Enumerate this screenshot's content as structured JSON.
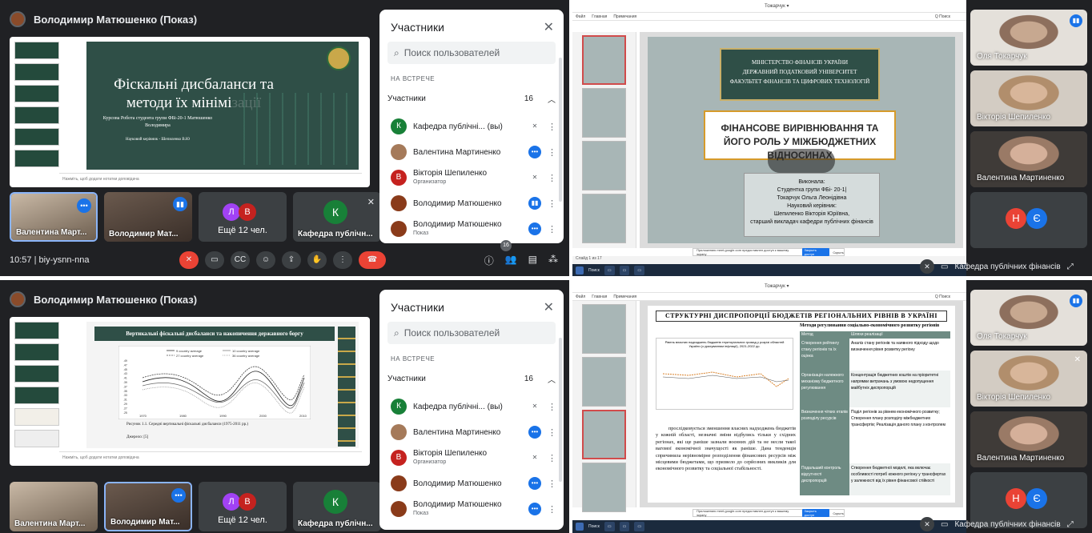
{
  "meet": {
    "presenter": "Володимир Матюшенко (Показ)",
    "slide1": {
      "title": "Фіскальні дисбаланси та методи їх мінімізації",
      "subtitle": "Курсова Робота студента групи ФБі-20-1 Матюшенко Володимира",
      "supervisor": "Науковий керівник - Шепиленко В.Ю",
      "notes": "Нажміть, щоб додати нотатки доповідача"
    },
    "slide2": {
      "title": "Вертикальні фіскальні дисбаланси та накопичення державного боргу",
      "caption": "Рисунок 1.1. Середні вертикальні фіскальні дисбаланси (1975-2011 рр.)",
      "source": "Джерело: [5]",
      "legend": [
        "9 country average",
        "10 country average",
        "27 country average",
        "36 country average"
      ],
      "xticks": [
        "1970",
        "1980",
        "1990",
        "2000",
        "2010"
      ],
      "yticks": [
        ".49",
        ".47",
        ".45",
        ".43",
        ".41",
        ".39",
        ".37",
        ".35",
        ".33",
        ".31",
        ".29",
        ".27",
        ".25"
      ]
    },
    "tiles": [
      {
        "name": "Валентина Март..."
      },
      {
        "name": "Володимир Мат..."
      },
      {
        "name": "Ещё 12 чел.",
        "avatars": [
          "Л",
          "В"
        ]
      },
      {
        "name": "Кафедра публічн...",
        "avatar": "К"
      }
    ],
    "panel": {
      "title": "Участники",
      "search_placeholder": "Поиск пользователей",
      "section": "НА ВСТРЕЧЕ",
      "group": "Участники",
      "count": "16",
      "people": [
        {
          "avatar": "К",
          "name": "Кафедра публічні... (вы)",
          "color": "#188038"
        },
        {
          "avatar": "",
          "name": "Валентина Мартиненко",
          "color": "#a57a5a"
        },
        {
          "avatar": "В",
          "name": "Вікторія Шепиленко",
          "sub": "Организатор",
          "color": "#c5221f"
        },
        {
          "avatar": "",
          "name": "Володимир Матюшенко",
          "color": "#8a3b1a"
        },
        {
          "avatar": "",
          "name": "Володимир Матюшенко",
          "sub": "Показ",
          "color": "#8a3b1a"
        }
      ]
    },
    "bottom": {
      "time": "10:57",
      "code": "biy-ysnn-nna",
      "badge": "16"
    }
  },
  "ppt": {
    "window_title": "Тожарчук ▾",
    "tabs": [
      "Файл",
      "Главная",
      "Примечания"
    ],
    "search": "Q Поиск",
    "slideA": {
      "header_lines": [
        "МІНІСТЕРСТВО ФІНАНСІВ УКРАЇНИ",
        "ДЕРЖАВНИЙ ПОДАТКОВИЙ УНІВЕРСИТЕТ",
        "ФАКУЛЬТЕТ ФІНАНСІВ ТА ЦИФРОВИХ ТЕХНОЛОГІЙ"
      ],
      "title": "ФІНАНСОВЕ ВИРІВНЮВАННЯ ТА ЙОГО РОЛЬ У МІЖБЮДЖЕТНИХ ВІДНОСИНАХ",
      "author": [
        "Виконала:",
        "Студентка групи ФБі- 20-1|",
        "Токарчук Ольга Леонідівна",
        "Науковий керівник:",
        "Шепиленко Вікторія Юріївна,",
        "старший викладач кафедри публічних фінансів"
      ]
    },
    "slideB": {
      "title": "СТРУКТУРНІ ДИСПРОПОРЦІЇ БЮДЖЕТІВ РЕГІОНАЛЬНИХ РІВНІВ В УКРАЇНІ",
      "table_title": "Методи регулювання соціально-економічного розвитку регіонів",
      "col1": "Метод",
      "col2": "Шляхи реалізації",
      "chart_title": "Рівень власних надходжень бюджетів територіальних громад у розрізі областей України (з урахуванням інфляції), 2021-2022 рр.",
      "body": "прослідковується зменшення власних надходжень бюджетів у кожній області, незначні зміни відбулись тільки у східних регіонах, які ще раніше зазнали воєнних дій та не несли такої вагомої економічної значущості як раніше. Дана тенденція спричинила нерівномірне розподілення фінансових ресурсів між місцевими бюджетами, що призвело до серйозних викликів для економічного розвитку та соціальної стабільності.",
      "rows": [
        {
          "m": "Створення рейтингу стану регіонів та їх оцінка",
          "w": "Аналіз стану регіонів та наявного підходу щодо визначення рівня розвитку регіону"
        },
        {
          "m": "Організація належного механізму бюджетного регулювання",
          "w": "Концентрація бюджетних коштів на пріоритетні напрямки витрачань з умовою недопущення майбутніх диспропорцій"
        },
        {
          "m": "Визначення чітких етапів розподілу ресурсів",
          "w": "Поділ регіонів за рівнем економічного розвитку; Створення плану розподілу міжбюджетних трансфертів; Реалізація даного плану з контролем"
        },
        {
          "m": "Подальший контроль відсутності диспропорцій",
          "w": "Створення бюджетної моделі, яка включає особливості потреб кожного регіону у трансфертах у залежності від їх рівня фінансової стійкості"
        }
      ]
    },
    "prompt": "Приложению meet.google.com предоставлен доступ к вашему экрану",
    "prompt_btn1": "Закрыть доступ",
    "prompt_btn2": "Скрыть",
    "taskbar_search": "Поиск",
    "status": "Слайд 1 из 17"
  },
  "side": {
    "tiles": [
      {
        "name": "Оля Токарчук"
      },
      {
        "name": "Вікторія Шепиленко"
      },
      {
        "name": "Валентина Мартиненко"
      },
      {
        "name": "",
        "avatars": [
          "Н",
          "Є"
        ]
      }
    ],
    "footer": "Кафедра публічних фінансів"
  }
}
